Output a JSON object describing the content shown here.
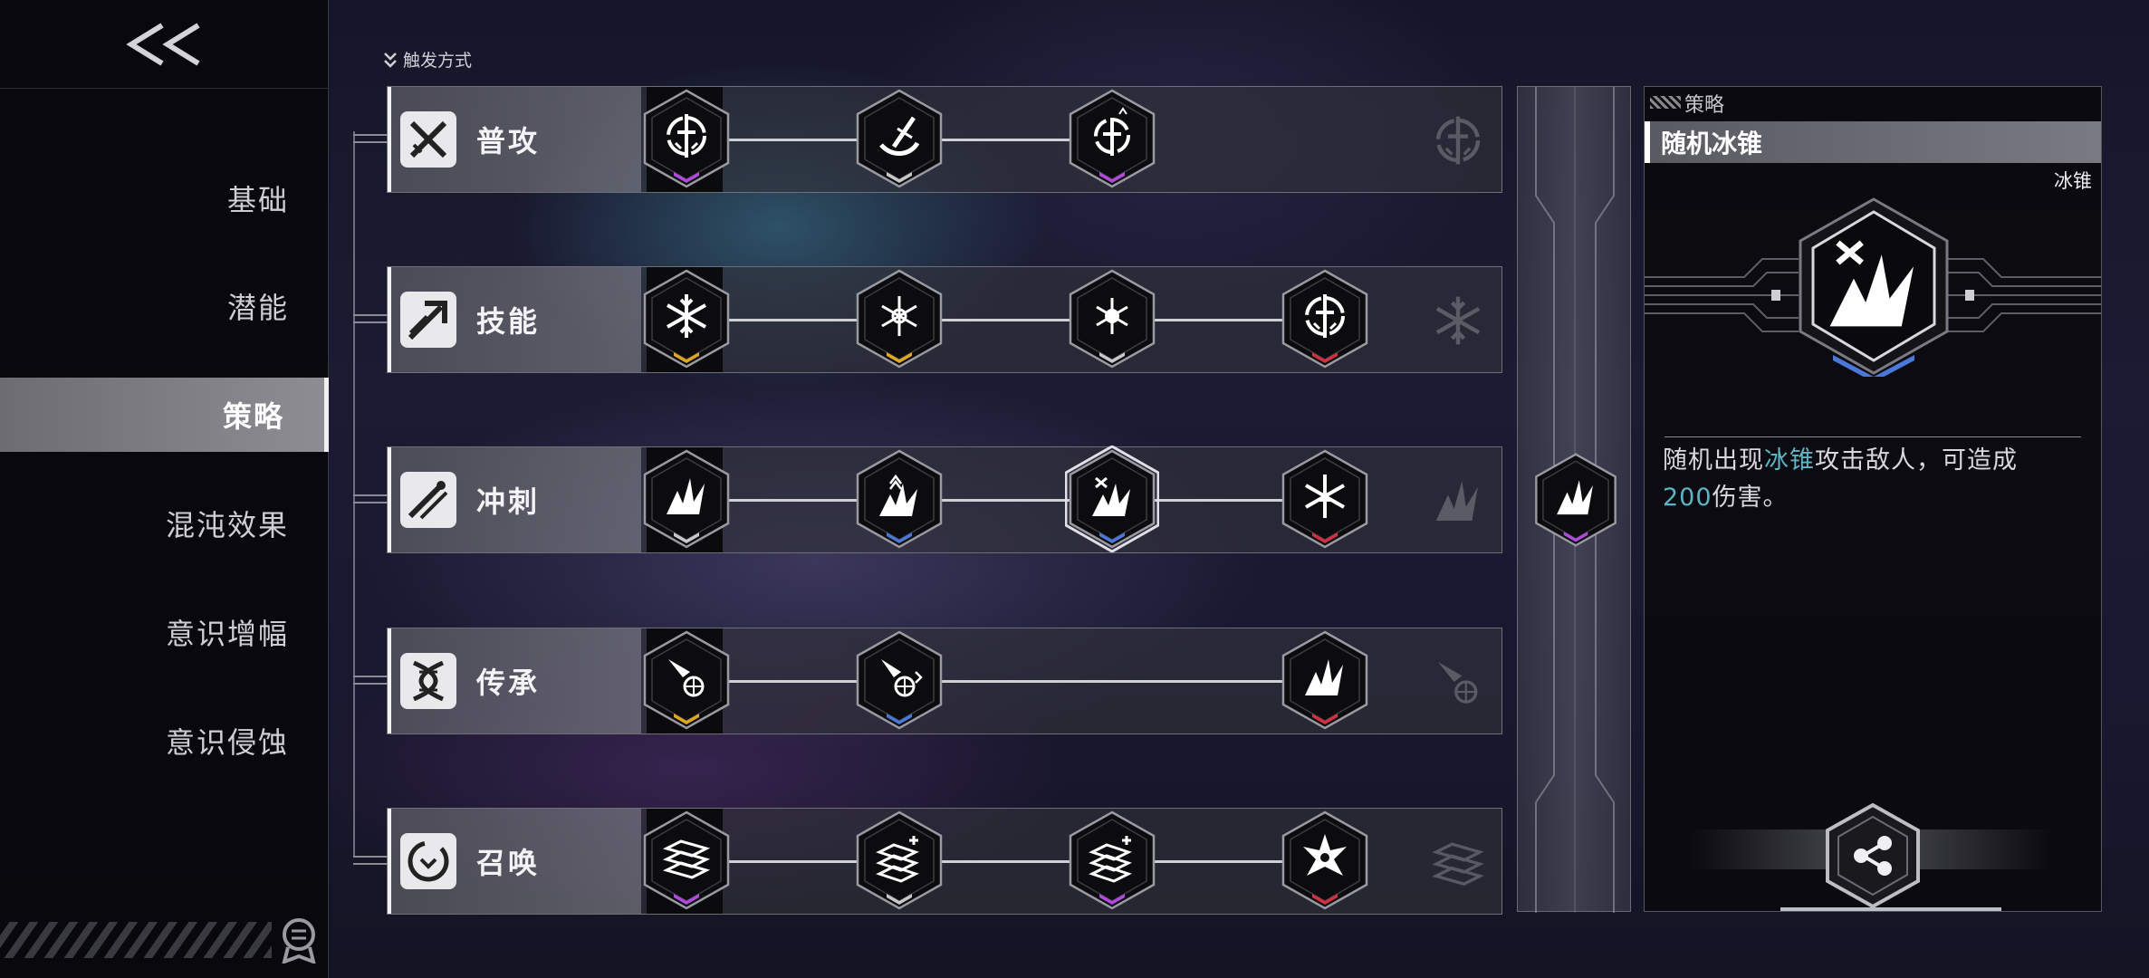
{
  "nav": {
    "back_label": "<<",
    "items": [
      "基础",
      "潜能",
      "策略",
      "混沌效果",
      "意识增幅",
      "意识侵蚀"
    ],
    "active_index": 2
  },
  "trigger_header": "触发方式",
  "rows": [
    {
      "title": "普攻",
      "icon": "crossed-swords-icon",
      "nodes": [
        "sword-target-icon",
        "sword-slash-icon",
        "sword-target-plus-icon"
      ],
      "node_colors": [
        "#b04adf",
        "#c8c8c8",
        "#b04adf"
      ]
    },
    {
      "title": "技能",
      "icon": "arrow-strike-icon",
      "nodes": [
        "snowflake-icon",
        "snowflake-burst-icon",
        "snowflake-core-icon",
        "sword-target-icon"
      ],
      "node_colors": [
        "#e0a820",
        "#e0a820",
        "#c8c8c8",
        "#d03040"
      ]
    },
    {
      "title": "冲刺",
      "icon": "dash-icon",
      "nodes": [
        "ice-spike-icon",
        "ice-spike-up-icon",
        "ice-spike-random-icon",
        "snowflake-spike-icon"
      ],
      "node_colors": [
        "#c8c8c8",
        "#4a78d8",
        "#4a78d8",
        "#d03040"
      ]
    },
    {
      "title": "传承",
      "icon": "dna-icon",
      "nodes": [
        "meteor-wheel-icon",
        "meteor-wheel-plus-icon",
        "ice-spike-icon"
      ],
      "node_colors": [
        "#e0a820",
        "#4a78d8",
        "#d03040"
      ]
    },
    {
      "title": "召唤",
      "icon": "summon-icon",
      "nodes": [
        "diamond-stack-icon",
        "diamond-stack-plus-icon",
        "diamond-stack-plus-icon",
        "star-crystal-icon"
      ],
      "node_colors": [
        "#b04adf",
        "#c8c8c8",
        "#b04adf",
        "#d03040"
      ]
    }
  ],
  "selected_node": {
    "icon": "ice-spike-icon",
    "color": "#b04adf"
  },
  "panel": {
    "category": "策略",
    "title": "随机冰锥",
    "tag": "冰锥",
    "desc_1": "随机出现",
    "desc_hl1": "冰锥",
    "desc_2": "攻击敌人，可造成",
    "desc_hl2": "200",
    "desc_3": "伤害。",
    "share_icon": "share-icon"
  },
  "colors": {
    "highlight": "#5fb4c4",
    "purple": "#b04adf",
    "gold": "#e0a820",
    "blue": "#4a78d8",
    "red": "#d03040"
  }
}
